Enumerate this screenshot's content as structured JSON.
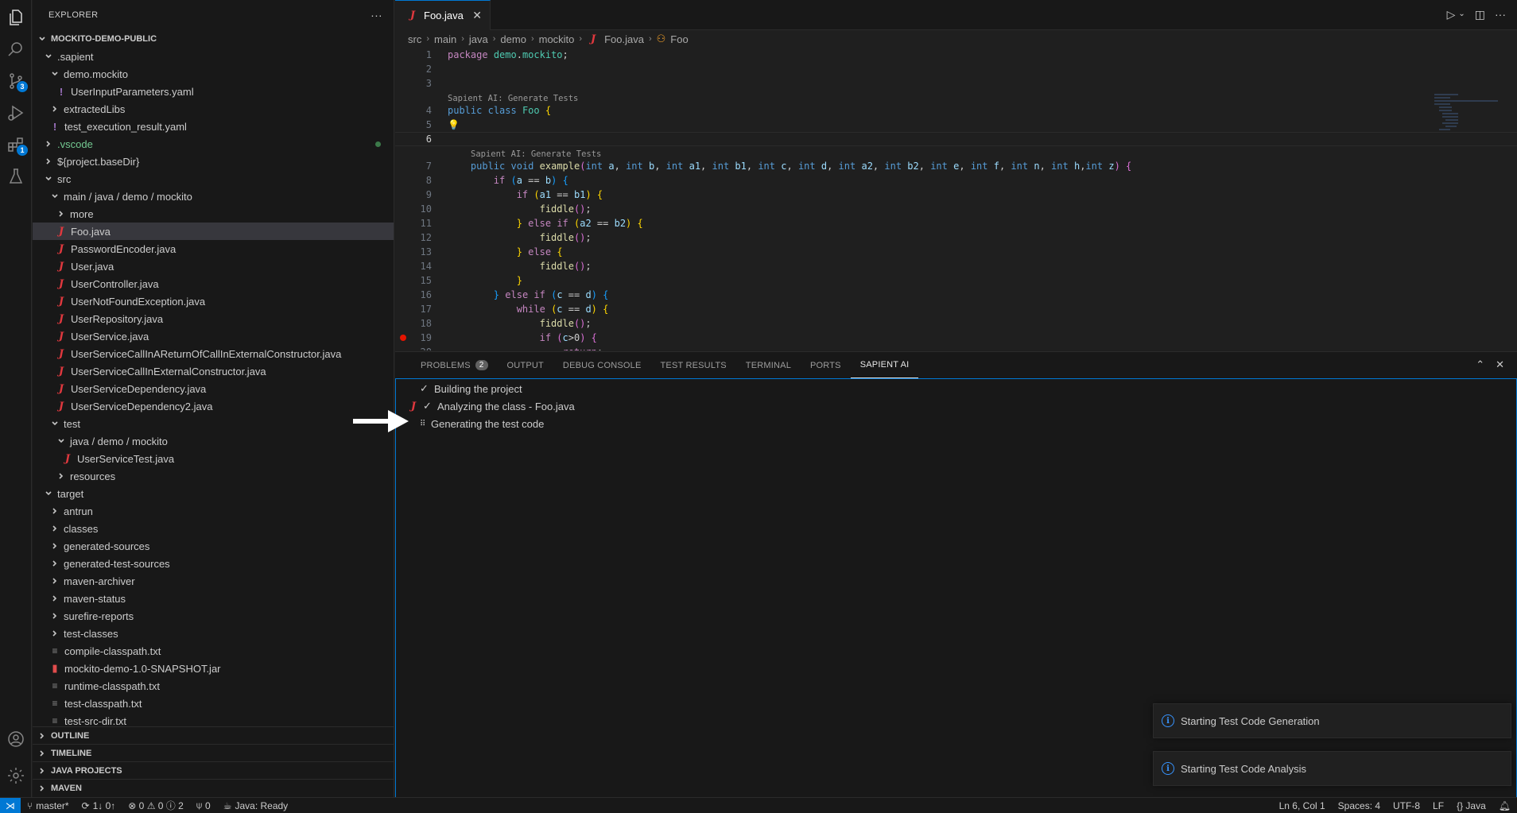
{
  "explorer": {
    "title": "EXPLORER",
    "more": "···",
    "root": "MOCKITO-DEMO-PUBLIC",
    "tree": [
      {
        "label": ".sapient",
        "depth": 1,
        "kind": "folder-open"
      },
      {
        "label": "demo.mockito",
        "depth": 2,
        "kind": "folder-open"
      },
      {
        "label": "UserInputParameters.yaml",
        "depth": 3,
        "kind": "yaml"
      },
      {
        "label": "extractedLibs",
        "depth": 2,
        "kind": "folder"
      },
      {
        "label": "test_execution_result.yaml",
        "depth": 2,
        "kind": "yaml"
      },
      {
        "label": ".vscode",
        "depth": 1,
        "kind": "folder",
        "dot": true
      },
      {
        "label": "${project.baseDir}",
        "depth": 1,
        "kind": "folder"
      },
      {
        "label": "src",
        "depth": 1,
        "kind": "folder-open"
      },
      {
        "label": "main / java / demo / mockito",
        "depth": 2,
        "kind": "folder-open"
      },
      {
        "label": "more",
        "depth": 3,
        "kind": "folder"
      },
      {
        "label": "Foo.java",
        "depth": 3,
        "kind": "java",
        "selected": true
      },
      {
        "label": "PasswordEncoder.java",
        "depth": 3,
        "kind": "java"
      },
      {
        "label": "User.java",
        "depth": 3,
        "kind": "java"
      },
      {
        "label": "UserController.java",
        "depth": 3,
        "kind": "java"
      },
      {
        "label": "UserNotFoundException.java",
        "depth": 3,
        "kind": "java"
      },
      {
        "label": "UserRepository.java",
        "depth": 3,
        "kind": "java"
      },
      {
        "label": "UserService.java",
        "depth": 3,
        "kind": "java"
      },
      {
        "label": "UserServiceCallInAReturnOfCallInExternalConstructor.java",
        "depth": 3,
        "kind": "java"
      },
      {
        "label": "UserServiceCallInExternalConstructor.java",
        "depth": 3,
        "kind": "java"
      },
      {
        "label": "UserServiceDependency.java",
        "depth": 3,
        "kind": "java"
      },
      {
        "label": "UserServiceDependency2.java",
        "depth": 3,
        "kind": "java"
      },
      {
        "label": "test",
        "depth": 2,
        "kind": "folder-open"
      },
      {
        "label": "java / demo / mockito",
        "depth": 3,
        "kind": "folder-open"
      },
      {
        "label": "UserServiceTest.java",
        "depth": 4,
        "kind": "java"
      },
      {
        "label": "resources",
        "depth": 3,
        "kind": "folder"
      },
      {
        "label": "target",
        "depth": 1,
        "kind": "folder-open"
      },
      {
        "label": "antrun",
        "depth": 2,
        "kind": "folder"
      },
      {
        "label": "classes",
        "depth": 2,
        "kind": "folder"
      },
      {
        "label": "generated-sources",
        "depth": 2,
        "kind": "folder"
      },
      {
        "label": "generated-test-sources",
        "depth": 2,
        "kind": "folder"
      },
      {
        "label": "maven-archiver",
        "depth": 2,
        "kind": "folder"
      },
      {
        "label": "maven-status",
        "depth": 2,
        "kind": "folder"
      },
      {
        "label": "surefire-reports",
        "depth": 2,
        "kind": "folder"
      },
      {
        "label": "test-classes",
        "depth": 2,
        "kind": "folder"
      },
      {
        "label": "compile-classpath.txt",
        "depth": 2,
        "kind": "txt"
      },
      {
        "label": "mockito-demo-1.0-SNAPSHOT.jar",
        "depth": 2,
        "kind": "jar"
      },
      {
        "label": "runtime-classpath.txt",
        "depth": 2,
        "kind": "txt"
      },
      {
        "label": "test-classpath.txt",
        "depth": 2,
        "kind": "txt"
      },
      {
        "label": "test-src-dir.txt",
        "depth": 2,
        "kind": "txt"
      }
    ],
    "sections": [
      "OUTLINE",
      "TIMELINE",
      "JAVA PROJECTS",
      "MAVEN"
    ]
  },
  "activity": {
    "source_control_badge": "3",
    "extensions_badge": "1"
  },
  "editor": {
    "tab": {
      "label": "Foo.java",
      "close": "✕"
    },
    "breadcrumb": [
      "src",
      "main",
      "java",
      "demo",
      "mockito",
      "Foo.java",
      "Foo"
    ],
    "codelens": "Sapient AI: Generate Tests"
  },
  "panel": {
    "tabs": [
      {
        "label": "PROBLEMS",
        "badge": "2"
      },
      {
        "label": "OUTPUT"
      },
      {
        "label": "DEBUG CONSOLE"
      },
      {
        "label": "TEST RESULTS"
      },
      {
        "label": "TERMINAL"
      },
      {
        "label": "PORTS"
      },
      {
        "label": "SAPIENT AI",
        "active": true
      }
    ],
    "steps": [
      {
        "mark": "✓",
        "label": "Building the project"
      },
      {
        "mark": "✓",
        "label": "Analyzing the class - Foo.java"
      },
      {
        "mark": "⠿",
        "label": "Generating the test code"
      }
    ]
  },
  "notifications": [
    "Starting Test Code Generation",
    "Starting Test Code Analysis"
  ],
  "statusbar": {
    "branch": "master*",
    "sync": "1↓ 0↑",
    "problems": "⊗ 0 ⚠ 0 ⓘ 2",
    "ports": "0",
    "java": "Java: Ready",
    "position": "Ln 6, Col 1",
    "spaces": "Spaces: 4",
    "encoding": "UTF-8",
    "eol": "LF",
    "language": "{} Java"
  },
  "colors": {
    "accent": "#0078d4",
    "java_icon": "#e0383e",
    "breakpoint": "#e51400"
  }
}
